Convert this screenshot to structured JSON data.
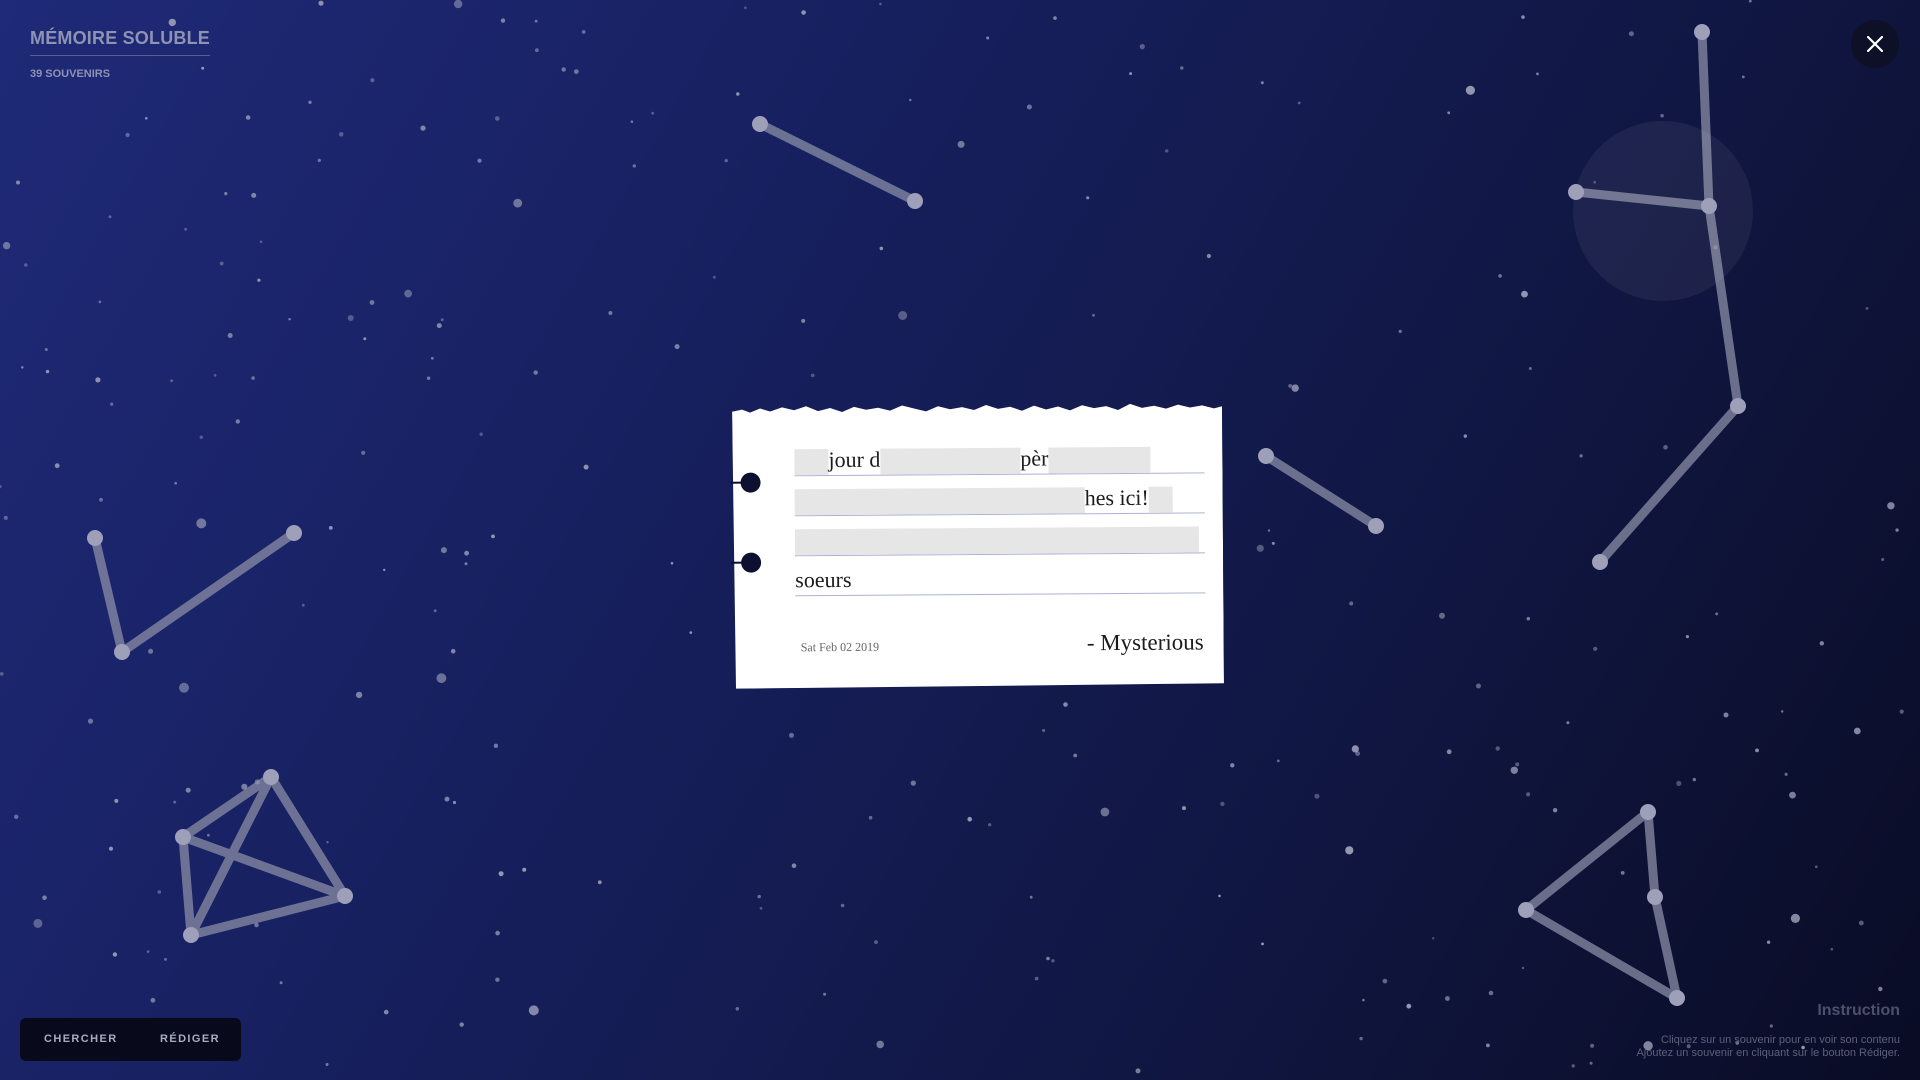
{
  "app": {
    "title": "MÉMOIRE SOLUBLE",
    "count": "39 SOUVENIRS"
  },
  "memory_card": {
    "lines": [
      [
        {
          "type": "redacted"
        },
        {
          "type": "text",
          "value": "jour d"
        },
        {
          "type": "redacted"
        },
        {
          "type": "text",
          "value": "pèr"
        },
        {
          "type": "redacted"
        }
      ],
      [
        {
          "type": "redacted"
        },
        {
          "type": "text",
          "value": "hes ici!"
        },
        {
          "type": "redacted"
        }
      ],
      [
        {
          "type": "redacted"
        }
      ],
      [
        {
          "type": "text",
          "value": "soeurs"
        }
      ]
    ],
    "date": "Sat Feb 02 2019",
    "author": "- Mysterious"
  },
  "toolbar": {
    "search_label": "CHERCHER",
    "write_label": "RÉDIGER"
  },
  "instructions": {
    "title": "Instruction",
    "line1": "Cliquez sur un souvenir pour en voir son contenu",
    "line2": "Ajoutez un souvenir en cliquant sur le bouton Rédiger."
  },
  "icons": {
    "close": "close-icon"
  },
  "colors": {
    "background_start": "#1f2a78",
    "background_end": "#0a0c25",
    "star": "#9da0b8",
    "constellation_line": "#8a8da6",
    "panel": "#080a1c"
  }
}
